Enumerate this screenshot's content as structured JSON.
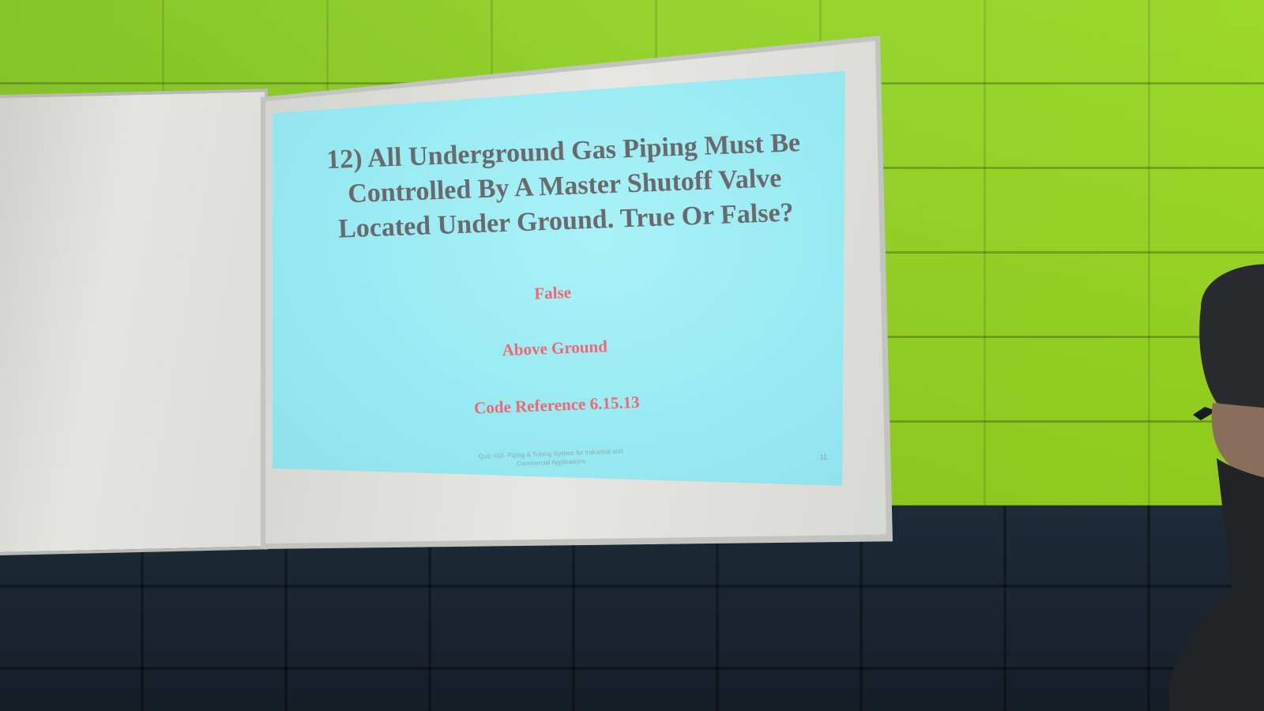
{
  "slide": {
    "question": "12) All Underground Gas Piping Must Be\nControlled By A Master Shutoff Valve\nLocated Under Ground. True Or False?",
    "answer_lines": [
      "False",
      "Above Ground",
      "Code Reference  6.15.13"
    ],
    "footer": "Quiz #10, Piping & Tubing System for Industrial and Commercial Applications",
    "page_number": "11"
  },
  "colors": {
    "wall_green": "#8fd022",
    "wall_navy": "#1d2a38",
    "slide_background": "#a0eef5",
    "question_text": "#6a6a6e",
    "answer_text": "#ee6874"
  }
}
